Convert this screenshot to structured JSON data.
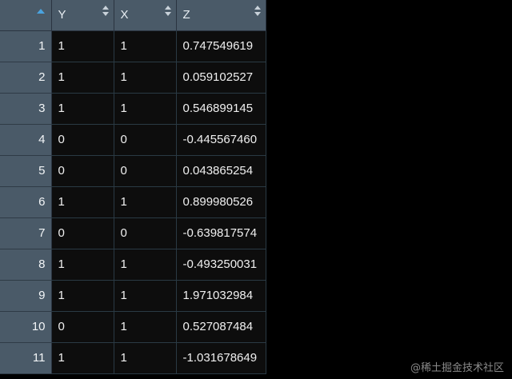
{
  "table": {
    "columns": [
      {
        "label": "",
        "sorted": "ascending"
      },
      {
        "label": "Y"
      },
      {
        "label": "X"
      },
      {
        "label": "Z"
      }
    ],
    "rows": [
      {
        "n": "1",
        "y": "1",
        "x": "1",
        "z": "0.747549619"
      },
      {
        "n": "2",
        "y": "1",
        "x": "1",
        "z": "0.059102527"
      },
      {
        "n": "3",
        "y": "1",
        "x": "1",
        "z": "0.546899145"
      },
      {
        "n": "4",
        "y": "0",
        "x": "0",
        "z": "-0.445567460"
      },
      {
        "n": "5",
        "y": "0",
        "x": "0",
        "z": "0.043865254"
      },
      {
        "n": "6",
        "y": "1",
        "x": "1",
        "z": "0.899980526"
      },
      {
        "n": "7",
        "y": "0",
        "x": "0",
        "z": "-0.639817574"
      },
      {
        "n": "8",
        "y": "1",
        "x": "1",
        "z": "-0.493250031"
      },
      {
        "n": "9",
        "y": "1",
        "x": "1",
        "z": "1.971032984"
      },
      {
        "n": "10",
        "y": "0",
        "x": "1",
        "z": "0.527087484"
      },
      {
        "n": "11",
        "y": "1",
        "x": "1",
        "z": "-1.031678649"
      }
    ]
  },
  "watermark": "@稀土掘金技术社区",
  "colors": {
    "header_bg": "#4a5a68",
    "cell_bg": "#0d0d0d",
    "sort_accent": "#4aa3df"
  }
}
